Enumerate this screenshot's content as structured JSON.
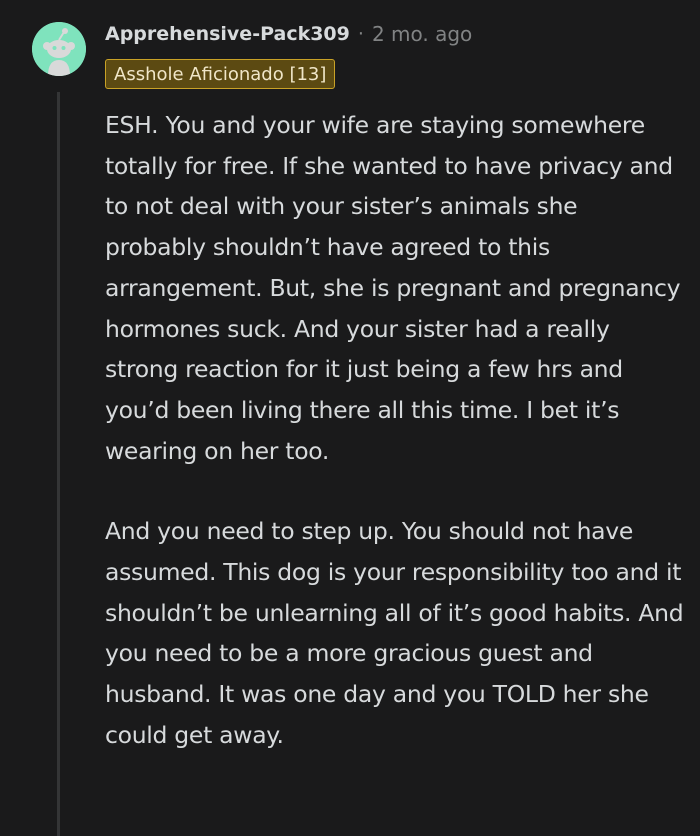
{
  "comment": {
    "author": "Apprehensive-Pack309",
    "separator": "·",
    "timestamp": "2 mo. ago",
    "flair": "Asshole Aficionado [13]",
    "paragraphs": [
      "ESH. You and your wife are staying somewhere totally for free. If she wanted to have privacy and to not deal with your sister’s animals she probably shouldn’t have agreed to this arrangement. But, she is pregnant and pregnancy hormones suck. And your sister had a really strong reaction for it just being a few hrs and you’d been living there all this time. I bet it’s wearing on her too.",
      "And you need to step up. You should not have assumed. This dog is your responsibility too and it shouldn’t be unlearning all of it’s good habits. And you need to be a more gracious guest and husband. It was one day and you TOLD her she could get away."
    ]
  },
  "colors": {
    "background": "#1a1a1b",
    "avatar_bg": "#7fe3bd",
    "flair_bg": "#5c4a12",
    "flair_border": "#c9a227",
    "text": "#d7dadc",
    "muted": "#818384"
  },
  "icons": {
    "avatar": "reddit-snoo-avatar-icon"
  }
}
